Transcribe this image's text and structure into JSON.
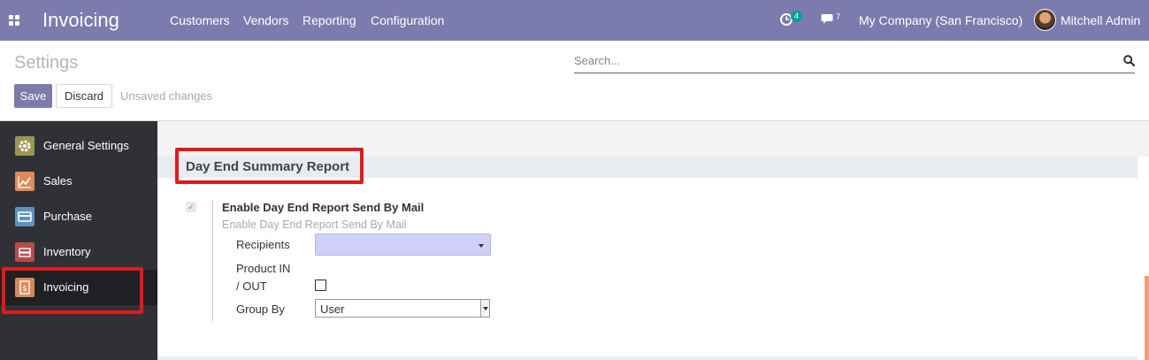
{
  "navbar": {
    "app_title": "Invoicing",
    "menu": [
      "Customers",
      "Vendors",
      "Reporting",
      "Configuration"
    ],
    "activity_badge": "4",
    "messages_badge": "7",
    "company": "My Company (San Francisco)",
    "user": "Mitchell Admin",
    "bg_color": "#7c7bad"
  },
  "control_panel": {
    "title": "Settings",
    "search_placeholder": "Search...",
    "save_label": "Save",
    "discard_label": "Discard",
    "status": "Unsaved changes"
  },
  "sidebar": {
    "items": [
      {
        "label": "General Settings",
        "icon": "gear-icon",
        "color": "#9c9654"
      },
      {
        "label": "Sales",
        "icon": "chart-line-icon",
        "color": "#e08a55"
      },
      {
        "label": "Purchase",
        "icon": "credit-card-icon",
        "color": "#5f93bf"
      },
      {
        "label": "Inventory",
        "icon": "boxes-icon",
        "color": "#b94a4a"
      },
      {
        "label": "Invoicing",
        "icon": "dollar-doc-icon",
        "color": "#d98958"
      }
    ],
    "active": "Invoicing"
  },
  "section": {
    "title": "Day End Summary Report",
    "option_title": "Enable Day End Report Send By Mail",
    "option_help": "Enable Day End Report Send By Mail",
    "recipients_label": "Recipients",
    "product_inout_label_1": "Product IN",
    "product_inout_label_2": "/ OUT",
    "group_by_label": "Group By",
    "group_by_value": "User"
  }
}
